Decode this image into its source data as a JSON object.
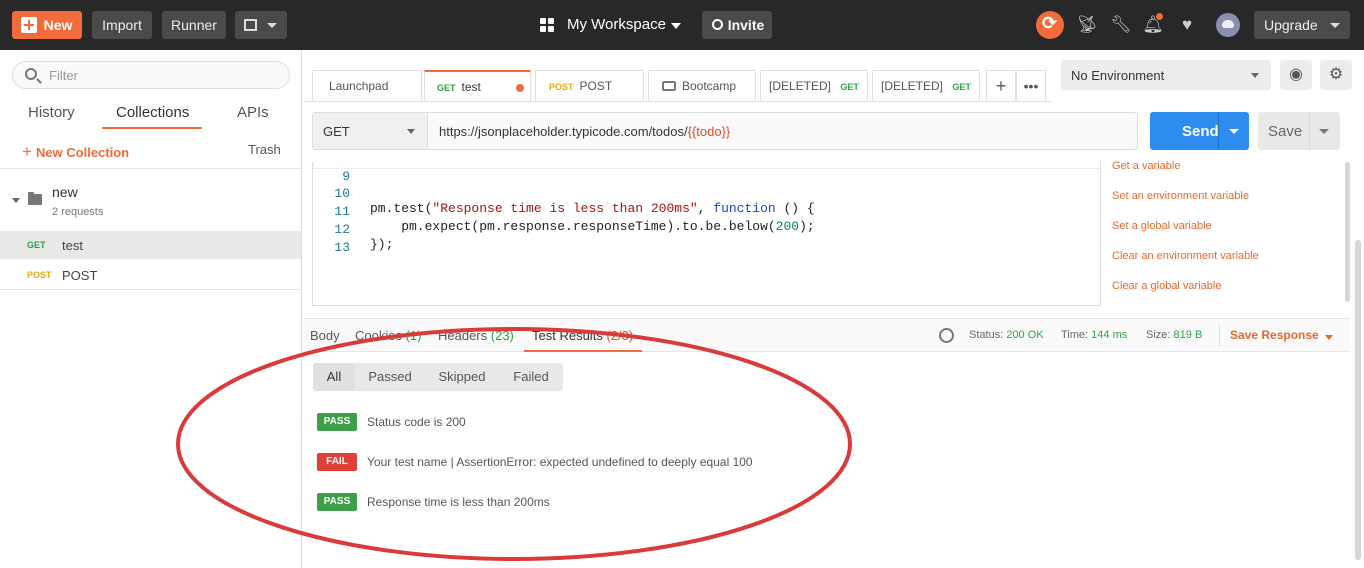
{
  "topbar": {
    "new_label": "New",
    "import_label": "Import",
    "runner_label": "Runner",
    "workspace_label": "My Workspace",
    "invite_label": "Invite",
    "upgrade_label": "Upgrade"
  },
  "sidebar": {
    "filter_placeholder": "Filter",
    "tabs": [
      {
        "label": "History"
      },
      {
        "label": "Collections"
      },
      {
        "label": "APIs"
      }
    ],
    "new_collection_label": "New Collection",
    "trash_label": "Trash",
    "collection": {
      "name": "new",
      "count": "2 requests"
    },
    "requests": [
      {
        "method": "GET",
        "name": "test"
      },
      {
        "method": "POST",
        "name": "POST"
      }
    ]
  },
  "tabs": [
    {
      "label": "Launchpad"
    },
    {
      "method": "GET",
      "label": "test"
    },
    {
      "method": "POST",
      "label": "POST"
    },
    {
      "label": "Bootcamp"
    },
    {
      "label": "[DELETED]",
      "method": "GET"
    },
    {
      "label": "[DELETED]",
      "method": "GET"
    }
  ],
  "environment": {
    "selected": "No Environment"
  },
  "request": {
    "method": "GET",
    "url_base": "https://jsonplaceholder.typicode.com/todos/",
    "url_var": "{{todo}}",
    "send_label": "Send",
    "save_label": "Save"
  },
  "editor": {
    "partial_line": "9",
    "lines": [
      {
        "no": "10",
        "a": "pm.test(",
        "s": "\"Response time is less than 200ms\"",
        "b": ", ",
        "k": "function",
        "c": " () {"
      },
      {
        "no": "11",
        "a": "    pm.expect(pm.response.responseTime).to.be.below(",
        "n": "200",
        "c": ");"
      },
      {
        "no": "12",
        "a": "});"
      },
      {
        "no": "13",
        "a": ""
      }
    ]
  },
  "snippets": [
    "Get a variable",
    "Set an environment variable",
    "Set a global variable",
    "Clear an environment variable",
    "Clear a global variable"
  ],
  "response": {
    "tabs": {
      "body": "Body",
      "cookies": "Cookies",
      "cookies_count": "(1)",
      "headers": "Headers",
      "headers_count": "(23)",
      "tests": "Test Results",
      "tests_count": "(2/3)"
    },
    "status_label": "Status:",
    "status_value": "200 OK",
    "time_label": "Time:",
    "time_value": "144 ms",
    "size_label": "Size:",
    "size_value": "819 B",
    "save_response_label": "Save Response",
    "filters": [
      "All",
      "Passed",
      "Skipped",
      "Failed"
    ],
    "results": [
      {
        "status": "PASS",
        "text": "Status code is 200"
      },
      {
        "status": "FAIL",
        "text": "Your test name | AssertionError: expected undefined to deeply equal 100"
      },
      {
        "status": "PASS",
        "text": "Response time is less than 200ms"
      }
    ]
  },
  "colors": {
    "accent": "#f26b3a",
    "send": "#2d8cf0",
    "pass": "#3f9e4a",
    "fail": "#e0403a",
    "annotation": "#d93a3a"
  }
}
